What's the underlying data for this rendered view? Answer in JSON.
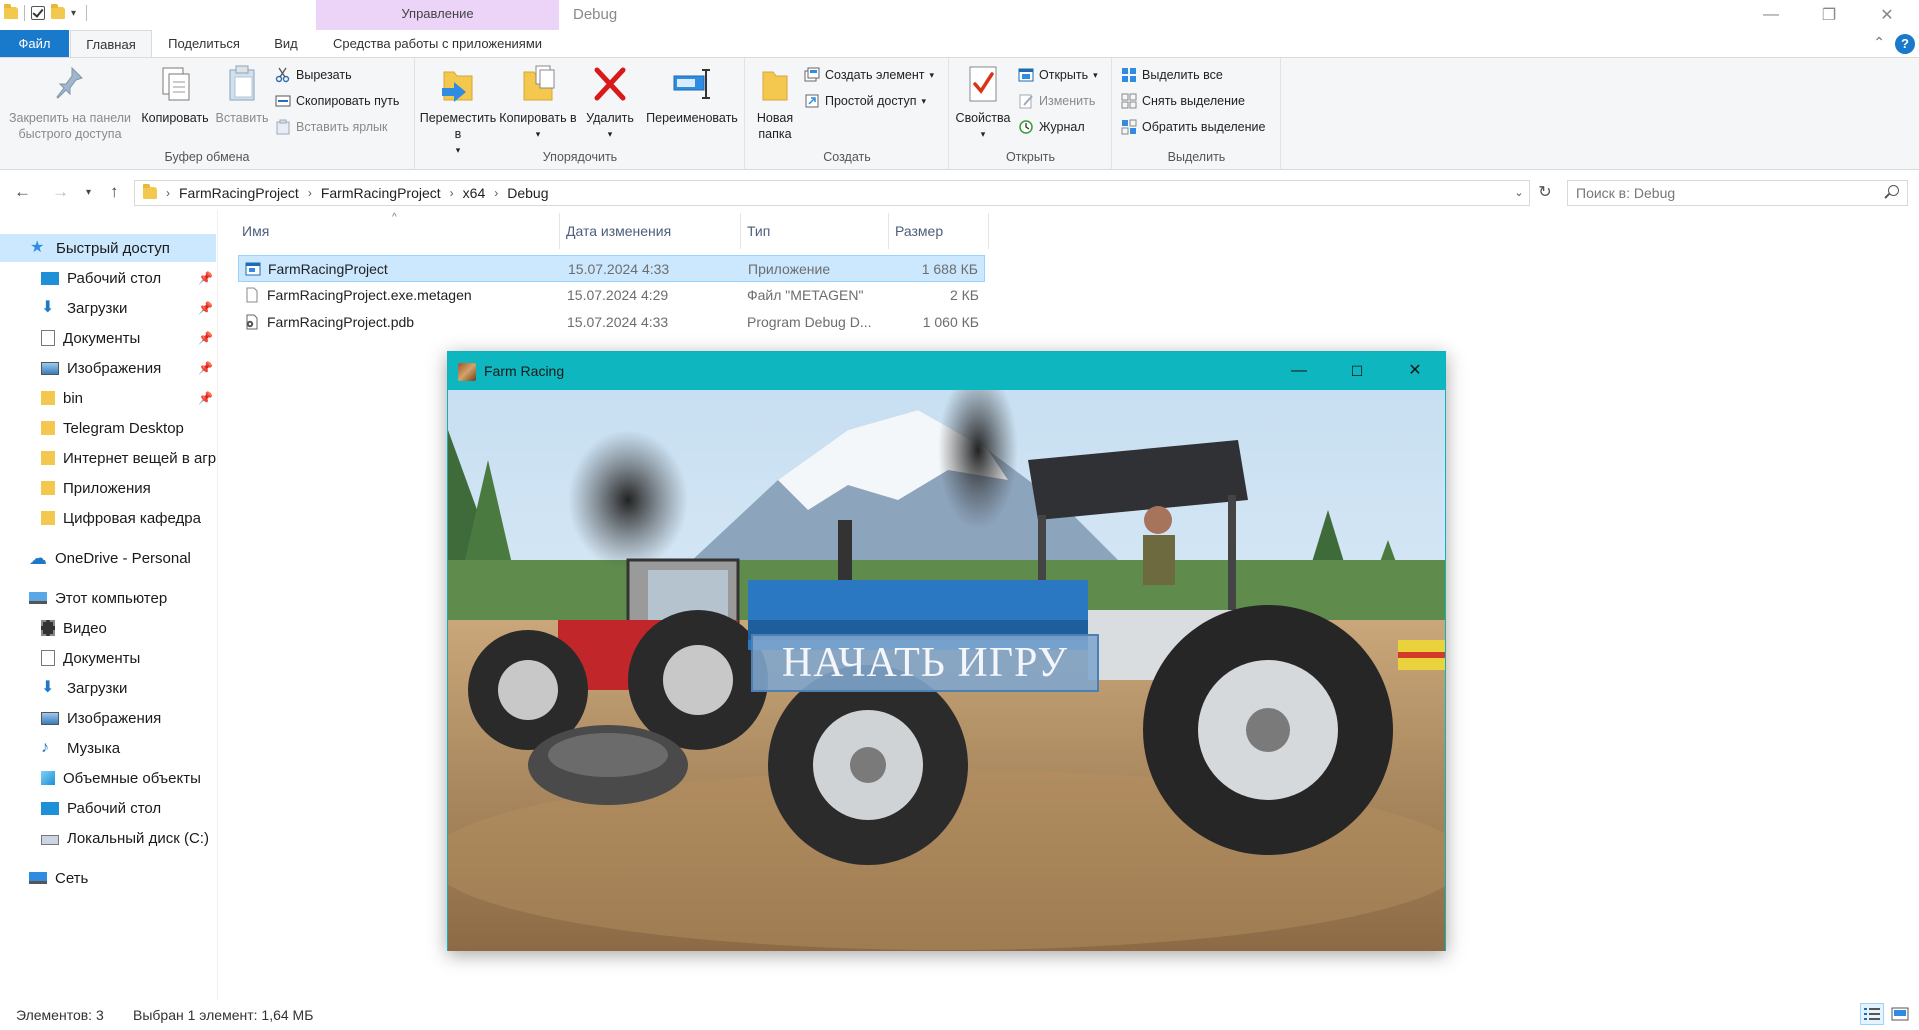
{
  "window": {
    "title": "Debug",
    "manage_tab_label": "Управление"
  },
  "ribbon_tabs": {
    "file": "Файл",
    "home": "Главная",
    "share": "Поделиться",
    "view": "Вид",
    "app_tools": "Средства работы с приложениями"
  },
  "ribbon": {
    "clipboard": {
      "title": "Буфер обмена",
      "pin": "Закрепить на панели быстрого доступа",
      "copy": "Копировать",
      "paste": "Вставить",
      "cut": "Вырезать",
      "copy_path": "Скопировать путь",
      "paste_shortcut": "Вставить ярлык"
    },
    "organize": {
      "title": "Упорядочить",
      "move_to": "Переместить в",
      "copy_to": "Копировать в",
      "delete": "Удалить",
      "rename": "Переименовать"
    },
    "new": {
      "title": "Создать",
      "new_folder": "Новая папка",
      "new_item": "Создать элемент",
      "easy_access": "Простой доступ"
    },
    "open": {
      "title": "Открыть",
      "properties": "Свойства",
      "open": "Открыть",
      "edit": "Изменить",
      "history": "Журнал"
    },
    "select": {
      "title": "Выделить",
      "select_all": "Выделить все",
      "select_none": "Снять выделение",
      "invert": "Обратить выделение"
    }
  },
  "address": {
    "crumbs": [
      "FarmRacingProject",
      "FarmRacingProject",
      "x64",
      "Debug"
    ],
    "search_placeholder": "Поиск в: Debug"
  },
  "nav_pane": {
    "quick_access": "Быстрый доступ",
    "quick_items": [
      "Рабочий стол",
      "Загрузки",
      "Документы",
      "Изображения",
      "bin",
      "Telegram Desktop",
      "Интернет вещей в агр",
      "Приложения",
      "Цифровая кафедра"
    ],
    "onedrive": "OneDrive - Personal",
    "this_pc": "Этот компьютер",
    "pc_items": [
      "Видео",
      "Документы",
      "Загрузки",
      "Изображения",
      "Музыка",
      "Объемные объекты",
      "Рабочий стол",
      "Локальный диск (C:)"
    ],
    "network": "Сеть"
  },
  "columns": {
    "name": "Имя",
    "date": "Дата изменения",
    "type": "Тип",
    "size": "Размер"
  },
  "files": [
    {
      "name": "FarmRacingProject",
      "date": "15.07.2024 4:33",
      "type": "Приложение",
      "size": "1 688 КБ",
      "selected": true,
      "icon": "exe-icon"
    },
    {
      "name": "FarmRacingProject.exe.metagen",
      "date": "15.07.2024 4:29",
      "type": "Файл \"METAGEN\"",
      "size": "2 КБ",
      "selected": false,
      "icon": "file-icon"
    },
    {
      "name": "FarmRacingProject.pdb",
      "date": "15.07.2024 4:33",
      "type": "Program Debug D...",
      "size": "1 060 КБ",
      "selected": false,
      "icon": "pdb-icon"
    }
  ],
  "status": {
    "count": "Элементов: 3",
    "selection": "Выбран 1 элемент: 1,64 МБ"
  },
  "game": {
    "title": "Farm Racing",
    "start_button": "НАЧАТЬ ИГРУ"
  },
  "colors": {
    "accent": "#1979ca",
    "selection": "#cce8ff",
    "game_titlebar": "#0eb6bf",
    "manage_tab": "#ecd4f9"
  }
}
